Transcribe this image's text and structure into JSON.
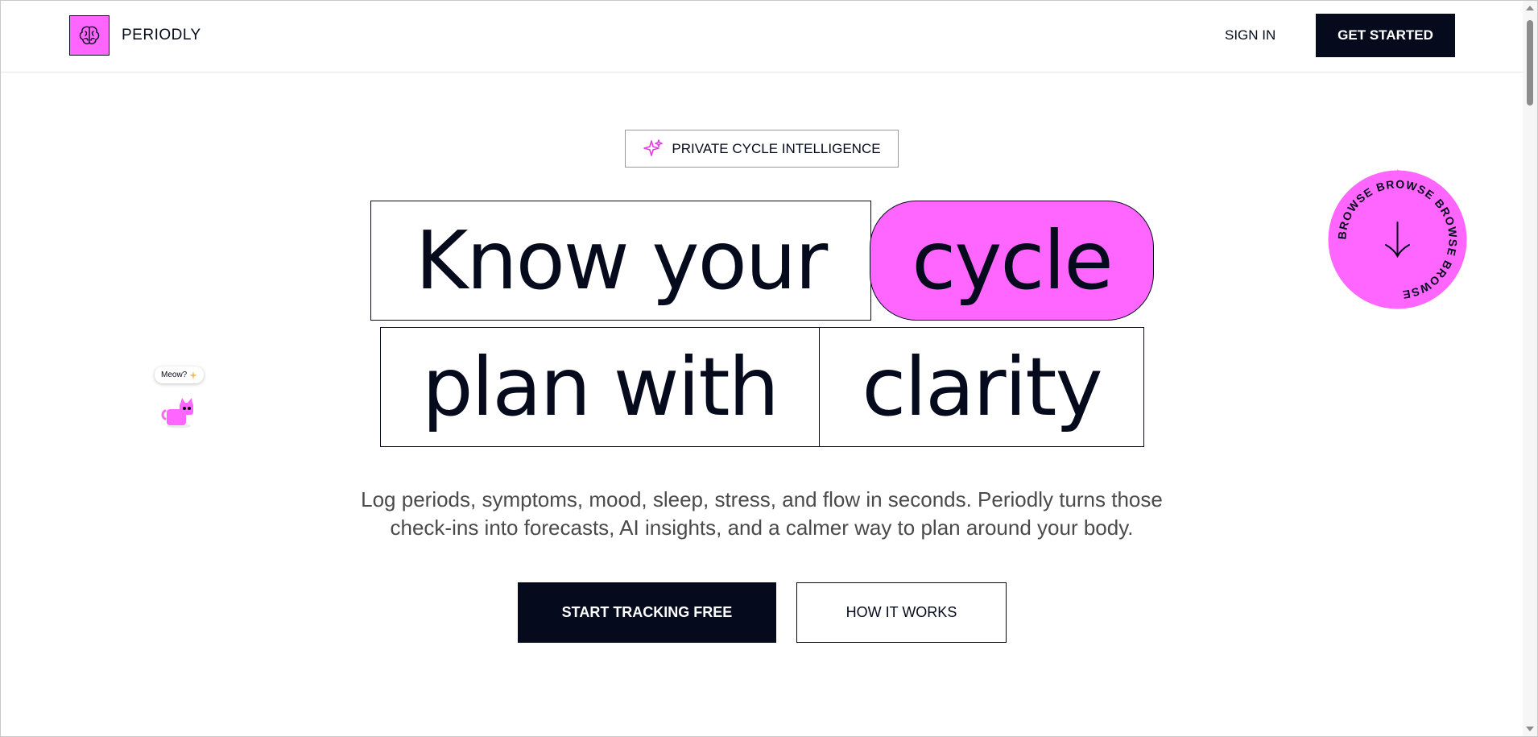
{
  "header": {
    "brand": "PERIODLY",
    "sign_in": "SIGN IN",
    "get_started": "GET STARTED"
  },
  "hero": {
    "badge": "PRIVATE CYCLE INTELLIGENCE",
    "line1_a": "Know your",
    "line1_b": "cycle",
    "line2_a": "plan with",
    "line2_b": "clarity",
    "description_1": "Log periods, symptoms, mood, sleep, stress, and flow in seconds. Periodly turns those",
    "description_2": "check-ins into forecasts, AI insights, and a calmer way to plan around your body.",
    "cta_primary": "START TRACKING FREE",
    "cta_secondary": "HOW IT WORKS"
  },
  "browse_seal": {
    "text": "BROWSE BROWSE BROWSE BROWSE ",
    "icon": "arrow-down-icon"
  },
  "mascot": {
    "bubble": "Meow?",
    "bubble_icon": "sparkle-icon",
    "icon": "cat-icon"
  },
  "colors": {
    "accent": "#ff66ff",
    "ink": "#050a1c",
    "muted_text": "#4a4a4a"
  }
}
